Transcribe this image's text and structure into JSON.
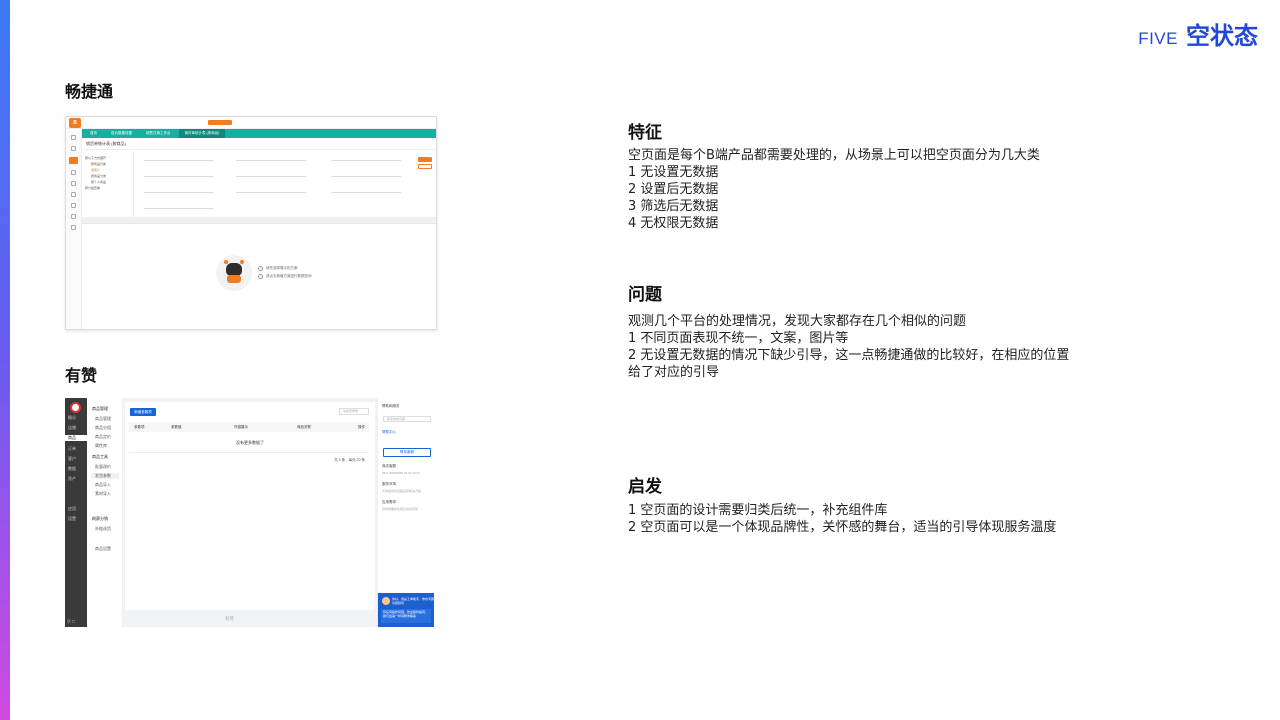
{
  "brand": {
    "five": "FIVE",
    "title": "空状态"
  },
  "cases": [
    {
      "label": "畅捷通"
    },
    {
      "label": "有赞"
    }
  ],
  "shot1": {
    "logo": "B",
    "tabs": [
      "首页",
      "进价数据设置",
      "销售日清工作台",
      "销货单统计表 (按商品)"
    ],
    "page_title": "销货单统计表 (按商品)",
    "tree_title": "按以下方式展开",
    "tree_items": [
      "按商品分类",
      "按客户",
      "按商品分类",
      "按个人商品",
      "按分组查看"
    ],
    "empty_hints": [
      "请先选择展示的方案",
      "或点击新增方案进行数据查询"
    ]
  },
  "shot2": {
    "dark_menu": [
      "概况",
      "店铺",
      "商品",
      "订单",
      "客户",
      "数据",
      "资产",
      "应用",
      "设置"
    ],
    "sub_head_1": "商品管理",
    "sub_items_1": [
      "商品管理",
      "商品分组",
      "商品定价",
      "属性库"
    ],
    "sub_head_2": "商品工具",
    "sub_items_2": [
      "批量改价",
      "发货参数",
      "商品导入",
      "素材导入"
    ],
    "sub_head_3": "刷赛分销",
    "sub_items_3": [
      "外链选货"
    ],
    "sub_extra": "商品设置",
    "new_button": "新增参数项",
    "search_placeholder": "请搜索参数",
    "columns": [
      "参数项",
      "参数值",
      "外链展示",
      "商品关联",
      "操作"
    ],
    "no_data": "没有更多数据了",
    "pager": "共 0 条，每页 20 条",
    "footer": "有赞",
    "right_title": "帮助和服务",
    "right_input": "搜索你的问题",
    "right_link": "帮助中心",
    "right_button": "联系客服",
    "right_items": [
      {
        "title": "商店客服",
        "sub": "0571-88888888 09:00-18:00"
      },
      {
        "title": "服务市场",
        "sub": "为你提供全链路运营解决方案"
      },
      {
        "title": "应用需求",
        "sub": "将你想要的功能反馈给有赞"
      }
    ],
    "card_title": "你好，我是工单助手，你的专属问题顾问",
    "card_body": "有任何操作问题，欢迎随时提问，我们会第一时间帮你解答"
  },
  "sections": [
    {
      "title": "特征",
      "lines": [
        "空页面是每个B端产品都需要处理的，从场景上可以把空页面分为几大类",
        "1 无设置无数据",
        "2 设置后无数据",
        "3 筛选后无数据",
        "4 无权限无数据"
      ]
    },
    {
      "title": "问题",
      "lines": [
        "观测几个平台的处理情况，发现大家都存在几个相似的问题",
        "1 不同页面表现不统一，文案，图片等",
        "2 无设置无数据的情况下缺少引导，这一点畅捷通做的比较好，在相应的位置",
        "给了对应的引导"
      ]
    },
    {
      "title": "启发",
      "lines": [
        "1 空页面的设计需要归类后统一，补充组件库",
        "2 空页面可以是一个体现品牌性，关怀感的舞台，适当的引导体现服务温度"
      ]
    }
  ]
}
